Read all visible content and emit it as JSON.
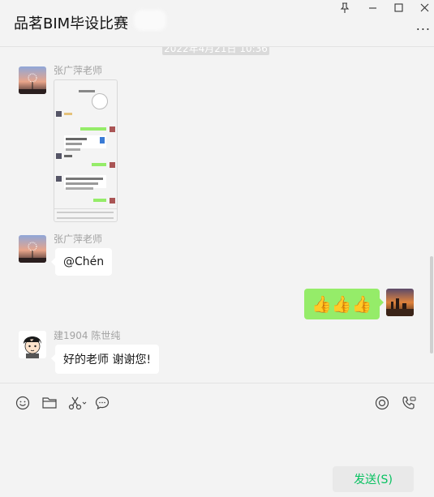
{
  "window": {
    "title": "品茗BIM毕设比赛",
    "pin_icon": "pin-icon",
    "minimize_icon": "minimize-icon",
    "maximize_icon": "maximize-icon",
    "close_icon": "close-icon",
    "more_label": "..."
  },
  "chat": {
    "timestamp": "2022年4月21日 10:36",
    "messages": [
      {
        "sender": "张广萍老师",
        "type": "image",
        "avatar": "dandelion-sunset"
      },
      {
        "sender": "张广萍老师",
        "type": "text",
        "text": "@Chén",
        "avatar": "dandelion-sunset"
      },
      {
        "sender": "me",
        "type": "emoji",
        "text": "👍👍👍",
        "avatar": "sunset-city"
      },
      {
        "sender": "建1904 陈世纯",
        "type": "text",
        "text": "好的老师  谢谢您!",
        "avatar": "cartoon-boy"
      }
    ]
  },
  "composer": {
    "tools_left": [
      "emoji-icon",
      "folder-icon",
      "scissors-icon",
      "chat-history-icon"
    ],
    "tools_right": [
      "live-icon",
      "voice-call-icon"
    ],
    "send_label": "发送(S)"
  },
  "colors": {
    "accent": "#07c160",
    "my_bubble": "#95ec69",
    "background": "#f3f3f3"
  }
}
